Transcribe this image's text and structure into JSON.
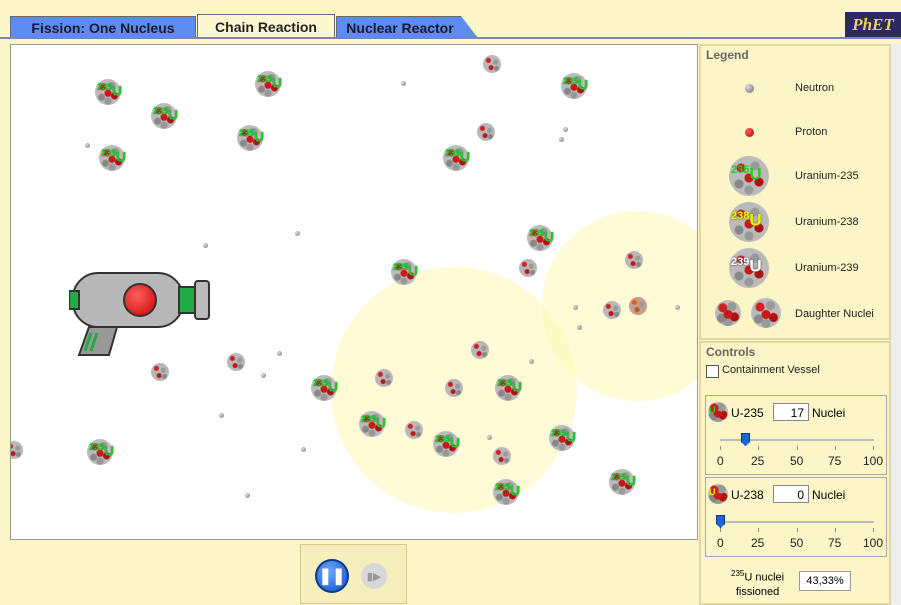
{
  "tabs": [
    {
      "label": "Fission: One Nucleus"
    },
    {
      "label": "Chain Reaction"
    },
    {
      "label": "Nuclear Reactor"
    }
  ],
  "brand": "PhET",
  "nucleus_labels": {
    "u235": "235",
    "u": "U",
    "u238": "238",
    "u239": "239"
  },
  "legend": {
    "title": "Legend",
    "items": [
      {
        "label": "Neutron"
      },
      {
        "label": "Proton"
      },
      {
        "label": "Uranium-235"
      },
      {
        "label": "Uranium-238"
      },
      {
        "label": "Uranium-239"
      },
      {
        "label": "Daughter Nuclei"
      }
    ]
  },
  "controls": {
    "title": "Controls",
    "containment_vessel_label": "Containment Vessel",
    "containment_vessel_checked": false,
    "u235": {
      "label": "U-235",
      "value": "17",
      "unit": "Nuclei",
      "fraction": 0.17
    },
    "u238": {
      "label": "U-238",
      "value": "0",
      "unit": "Nuclei",
      "fraction": 0.0
    },
    "slider_ticks": [
      "0",
      "25",
      "50",
      "75",
      "100"
    ],
    "fissioned_super": "235",
    "fissioned_label_1": "U nuclei",
    "fissioned_label_2": "fissioned",
    "fissioned_value": "43,33%"
  },
  "playback": {
    "pause_icon": "pause-icon",
    "step_icon": "step-icon"
  },
  "colors": {
    "tab_inactive": "#5c8cf0",
    "panel_bg": "#fbf5c8",
    "u235_label": "#22cc22",
    "u238_label": "#eeee00",
    "gun_accent": "#22aa44",
    "fire_button": "#ee1111"
  }
}
